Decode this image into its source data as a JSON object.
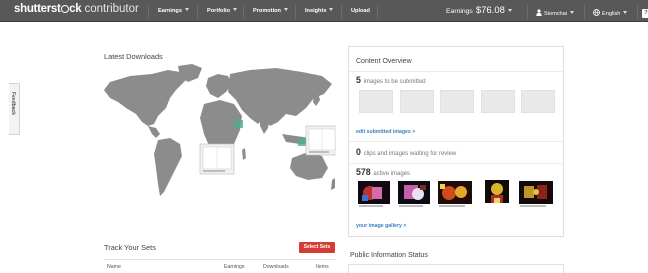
{
  "header": {
    "brand": "shutterst",
    "brand_mid": "ck",
    "brand_suffix": " contributor",
    "nav": [
      {
        "label": "Earnings"
      },
      {
        "label": "Portfolio"
      },
      {
        "label": "Promotion"
      },
      {
        "label": "Insights"
      },
      {
        "label": "Upload"
      }
    ],
    "earnings_label": "Earnings",
    "earnings_amount": "$76.08",
    "user": "Siomchai",
    "language": "English",
    "help": "?"
  },
  "feedback_tab": "Feedback",
  "latest_downloads": {
    "title": "Latest Downloads"
  },
  "track_sets": {
    "title": "Track Your Sets",
    "select_button": "Select Sets",
    "columns": [
      "Name",
      "Earnings",
      "Downloads",
      "Items"
    ]
  },
  "content_overview": {
    "title": "Content Overview",
    "to_submit_count": "5",
    "to_submit_text": "images to be submitted",
    "edit_link": "edit submitted images >",
    "waiting_count": "0",
    "waiting_text": "clips and images waiting for review",
    "active_count": "578",
    "active_text": "active images",
    "gallery_link": "your image gallery >"
  },
  "public_info": {
    "title": "Public Information Status"
  },
  "colors": {
    "topbar": "#585858",
    "accent_red": "#d43c35",
    "link_blue": "#3a7fbf",
    "map_land": "#8c8c8c"
  }
}
